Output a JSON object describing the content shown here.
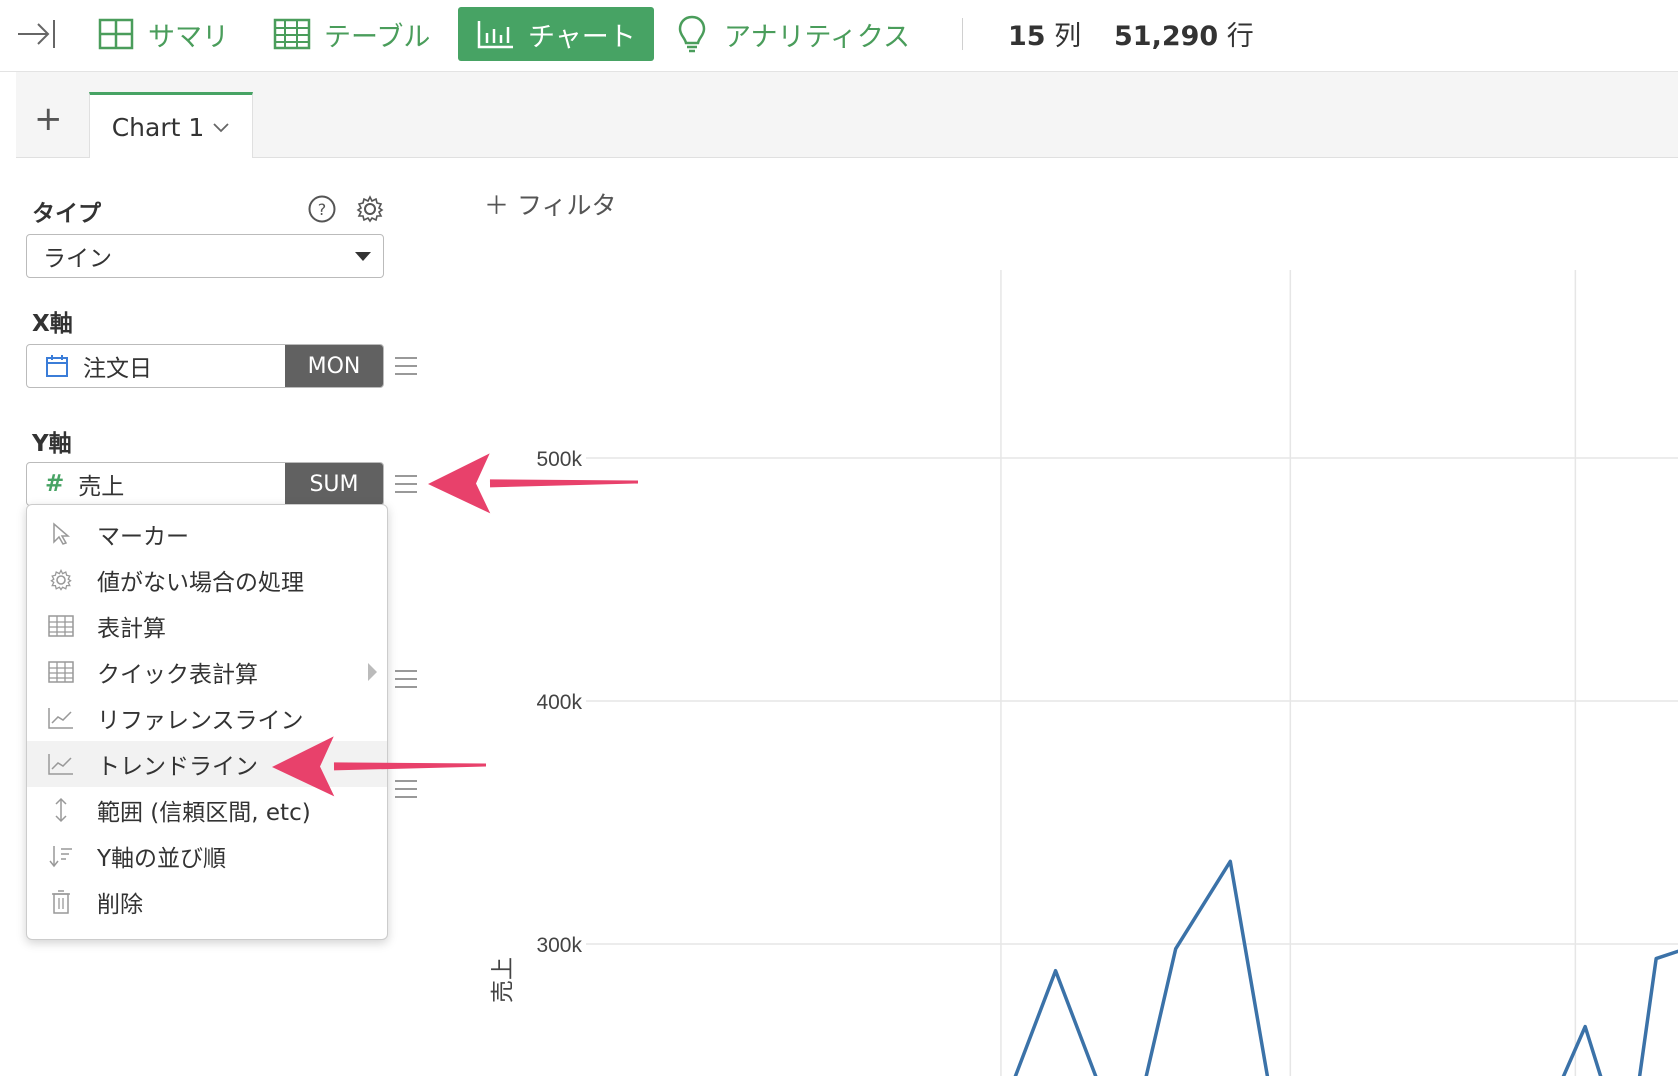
{
  "toolbar": {
    "tabs": [
      {
        "label": "サマリ",
        "icon": "grid-icon"
      },
      {
        "label": "テーブル",
        "icon": "table-icon"
      },
      {
        "label": "チャート",
        "icon": "bar-chart-icon",
        "active": true
      },
      {
        "label": "アナリティクス",
        "icon": "lightbulb-icon"
      }
    ],
    "columns_count": "15",
    "columns_unit": "列",
    "rows_count": "51,290",
    "rows_unit": "行",
    "accent_color": "#47a364"
  },
  "chart_tabs": {
    "add_label": "+",
    "current_tab": "Chart 1"
  },
  "config": {
    "type_label": "タイプ",
    "type_value": "ライン",
    "x_label": "X軸",
    "x_field": "注文日",
    "x_agg": "MON",
    "y_label": "Y軸",
    "y_field_symbol": "#",
    "y_field": "売上",
    "y_agg": "SUM"
  },
  "dropdown_menu": {
    "items": [
      {
        "label": "マーカー",
        "icon": "cursor-icon"
      },
      {
        "label": "値がない場合の処理",
        "icon": "gear-icon"
      },
      {
        "label": "表計算",
        "icon": "table-icon"
      },
      {
        "label": "クイック表計算",
        "icon": "table-icon",
        "submenu": true
      },
      {
        "label": "リファレンスライン",
        "icon": "line-chart-icon"
      },
      {
        "label": "トレンドライン",
        "icon": "line-chart-icon",
        "highlighted": true
      },
      {
        "label": "範囲 (信頼区間, etc)",
        "icon": "range-icon"
      },
      {
        "label": "Y軸の並び順",
        "icon": "sort-icon"
      },
      {
        "label": "削除",
        "icon": "trash-icon"
      }
    ]
  },
  "filter_label": "＋ フィルタ",
  "chart_data": {
    "type": "line",
    "ylabel": "売上",
    "y_ticks": [
      "500k",
      "400k",
      "300k"
    ],
    "series": [
      {
        "points": [
          [
            0.38,
            230000
          ],
          [
            0.43,
            289000
          ],
          [
            0.48,
            230000
          ],
          [
            0.505,
            230000
          ],
          [
            0.54,
            298000
          ],
          [
            0.59,
            334000
          ],
          [
            0.63,
            230000
          ]
        ]
      },
      {
        "points": [
          [
            0.88,
            230000
          ],
          [
            0.915,
            266000
          ],
          [
            0.94,
            230000
          ],
          [
            0.96,
            230000
          ],
          [
            0.98,
            294000
          ],
          [
            1.04,
            303000
          ],
          [
            1.09,
            230000
          ]
        ]
      }
    ],
    "line_color": "#3b72a8",
    "arrow_color": "#e8416b"
  }
}
